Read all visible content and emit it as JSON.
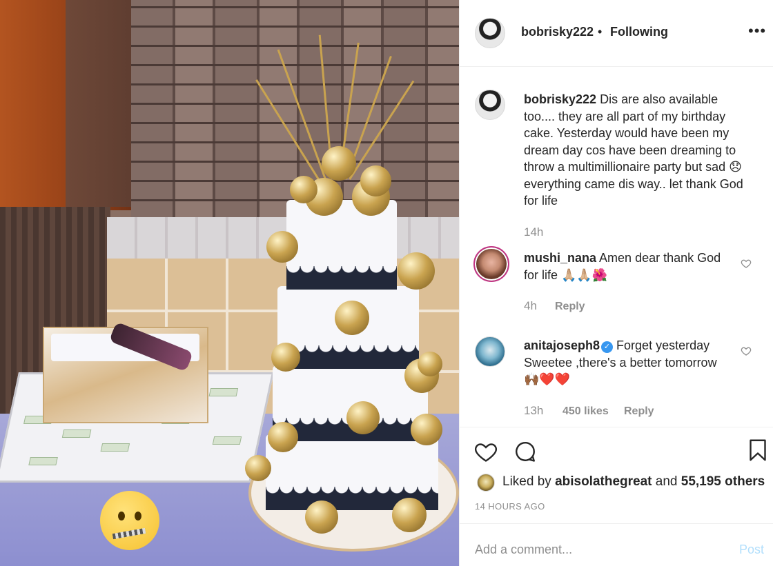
{
  "post": {
    "author": "bobrisky222",
    "follow_status": "Following",
    "separator": "•",
    "more_label": "•••"
  },
  "caption": {
    "username": "bobrisky222",
    "text": "Dis are also available too.... they are all part of my birthday cake. Yesterday would have been my dream day cos have been dreaming to throw a multimillionaire party but sad 😞 everything came dis way.. let thank God for life",
    "time": "14h"
  },
  "comments": [
    {
      "username": "mushi_nana",
      "text": "Amen dear thank God for life 🙏🏼🙏🏼🌺",
      "time": "4h",
      "reply_label": "Reply",
      "likes": ""
    },
    {
      "username": "anitajoseph8",
      "verified": "✓",
      "text": "Forget yesterday Sweetee ,there's a better tomorrow 🙌🏾❤️❤️",
      "time": "13h",
      "likes": "450 likes",
      "reply_label": "Reply"
    }
  ],
  "engagement": {
    "liked_by_prefix": "Liked by",
    "liked_by_user": "abisolathegreat",
    "liked_by_suffix": "and",
    "others": "55,195 others",
    "timestamp": "14 HOURS AGO"
  },
  "composer": {
    "placeholder": "Add a comment...",
    "post_label": "Post"
  },
  "icons": {
    "like": "heart-icon",
    "comment": "comment-bubble-icon",
    "save": "bookmark-icon",
    "more": "more-options-icon"
  },
  "colors": {
    "link_blue": "#3897f0",
    "muted": "#8e8e8e",
    "post_disabled": "#b2dffc"
  }
}
